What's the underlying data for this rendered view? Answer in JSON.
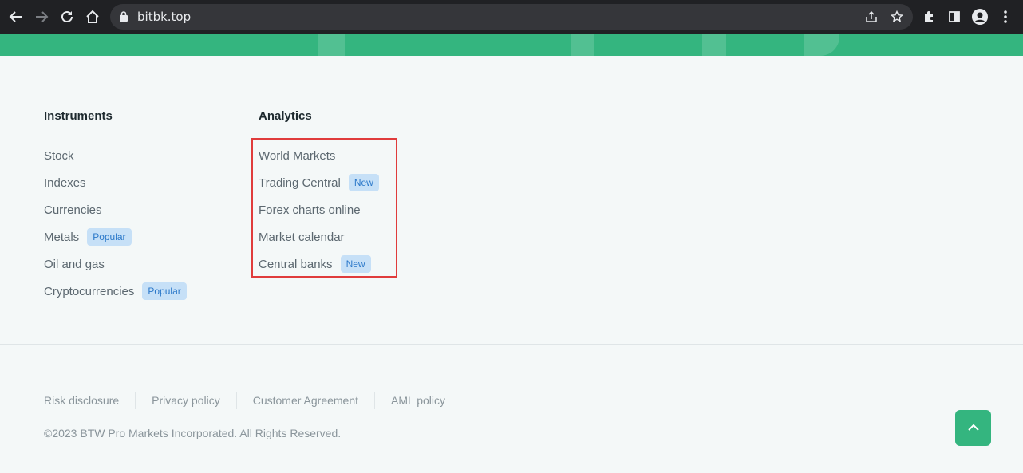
{
  "browser": {
    "url": "bitbk.top"
  },
  "instruments": {
    "title": "Instruments",
    "items": [
      {
        "label": "Stock",
        "badge": ""
      },
      {
        "label": "Indexes",
        "badge": ""
      },
      {
        "label": "Currencies",
        "badge": ""
      },
      {
        "label": "Metals",
        "badge": "Popular"
      },
      {
        "label": "Oil and gas",
        "badge": ""
      },
      {
        "label": "Cryptocurrencies",
        "badge": "Popular"
      }
    ]
  },
  "analytics": {
    "title": "Analytics",
    "items": [
      {
        "label": "World Markets",
        "badge": ""
      },
      {
        "label": "Trading Central",
        "badge": "New"
      },
      {
        "label": "Forex charts online",
        "badge": ""
      },
      {
        "label": "Market calendar",
        "badge": ""
      },
      {
        "label": "Central banks",
        "badge": "New"
      }
    ]
  },
  "legal": {
    "links": [
      "Risk disclosure",
      "Privacy policy",
      "Customer Agreement",
      "AML policy"
    ]
  },
  "copyright": "©2023 BTW Pro Markets Incorporated. All Rights Reserved.",
  "colors": {
    "brand_green": "#34b57f",
    "badge_bg": "#c6e0f7",
    "badge_text": "#2b78c9",
    "highlight_border": "#e03c3c"
  },
  "icons": {
    "scroll_top": "chevron-up-icon"
  }
}
